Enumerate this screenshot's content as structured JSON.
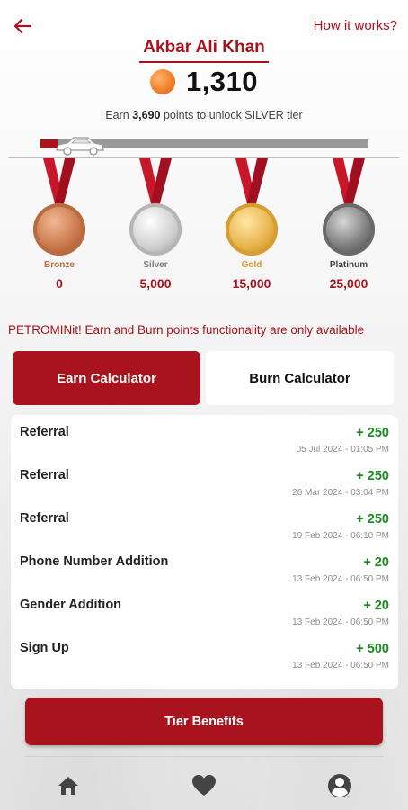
{
  "header": {
    "how_it_works": "How it works?",
    "user_name": "Akbar Ali Khan",
    "points": "1,310",
    "earn_prefix": "Earn",
    "earn_points": "3,690",
    "earn_suffix": "points to unlock SILVER tier"
  },
  "progress": {
    "fraction": 0.052
  },
  "tiers": [
    {
      "label": "Bronze",
      "points": "0",
      "label_color": "#b86e41"
    },
    {
      "label": "Silver",
      "points": "5,000",
      "label_color": "#7a7a7a"
    },
    {
      "label": "Gold",
      "points": "15,000",
      "label_color": "#d19a2a"
    },
    {
      "label": "Platinum",
      "points": "25,000",
      "label_color": "#444444"
    }
  ],
  "ticker": "PETROMINit! Earn and Burn points functionality are only available",
  "tabs": {
    "earn": "Earn Calculator",
    "burn": "Burn Calculator"
  },
  "transactions": [
    {
      "title": "Referral",
      "points": "+ 250",
      "date": "05 Jul 2024 - 01:05 PM"
    },
    {
      "title": "Referral",
      "points": "+ 250",
      "date": "26 Mar 2024 - 03:04 PM"
    },
    {
      "title": "Referral",
      "points": "+ 250",
      "date": "19 Feb 2024 - 06:10 PM"
    },
    {
      "title": "Phone Number Addition",
      "points": "+ 20",
      "date": "13 Feb 2024 - 06:50 PM"
    },
    {
      "title": "Gender Addition",
      "points": "+ 20",
      "date": "13 Feb 2024 - 06:50 PM"
    },
    {
      "title": "Sign Up",
      "points": "+ 500",
      "date": "13 Feb 2024 - 06:50 PM"
    }
  ],
  "tier_benefits_button": "Tier Benefits",
  "nav": [
    "home-icon",
    "heart-icon",
    "profile-icon"
  ],
  "colors": {
    "brand_red": "#a8131d",
    "points_green": "#1e8a23"
  }
}
